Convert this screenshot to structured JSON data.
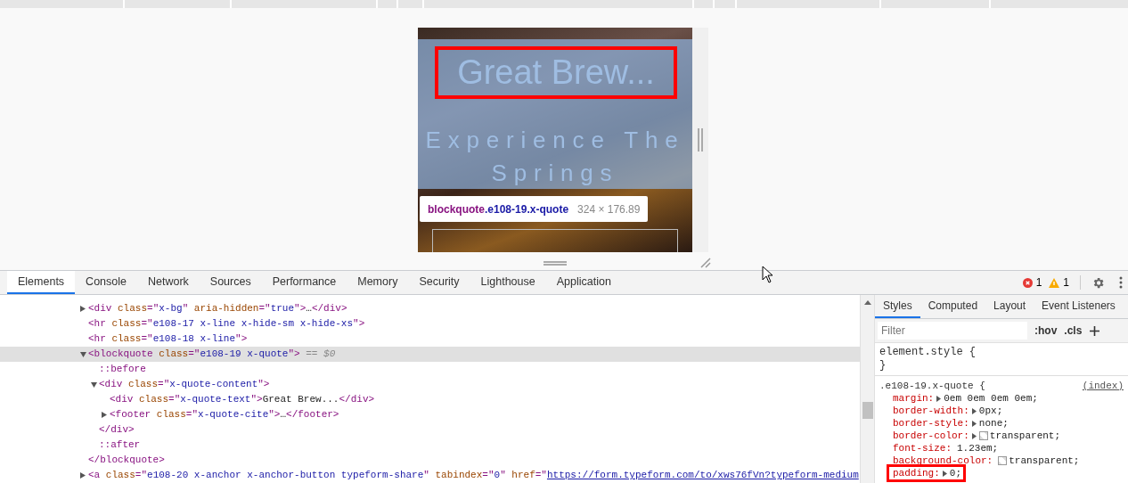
{
  "preview": {
    "quote_text": "Great Brew...",
    "quote_highlighted": true,
    "subtitle": "Experience The Springs",
    "tooltip": {
      "selector": "blockquote",
      "classes": ".e108-19.x-quote",
      "size": "324 × 176.89"
    }
  },
  "devtools": {
    "tabs": [
      {
        "label": "Elements",
        "selected": true
      },
      {
        "label": "Console",
        "selected": false
      },
      {
        "label": "Network",
        "selected": false
      },
      {
        "label": "Sources",
        "selected": false
      },
      {
        "label": "Performance",
        "selected": false
      },
      {
        "label": "Memory",
        "selected": false
      },
      {
        "label": "Security",
        "selected": false
      },
      {
        "label": "Lighthouse",
        "selected": false
      },
      {
        "label": "Application",
        "selected": false
      }
    ],
    "errors": "1",
    "warnings": "1",
    "dom_tree": [
      {
        "parts": [
          {
            "kind": "tag",
            "text": "<div "
          },
          {
            "kind": "attr",
            "text": "class"
          },
          {
            "kind": "tag",
            "text": "=\""
          },
          {
            "kind": "value",
            "text": "x-bg"
          },
          {
            "kind": "tag",
            "text": "\" "
          },
          {
            "kind": "attr",
            "text": "aria-hidden"
          },
          {
            "kind": "tag",
            "text": "=\""
          },
          {
            "kind": "value",
            "text": "true"
          },
          {
            "kind": "tag",
            "text": "\">"
          },
          {
            "kind": "text",
            "text": "…"
          },
          {
            "kind": "tag",
            "text": "</div>"
          }
        ],
        "expandable": true,
        "expanded": false,
        "selected": false
      },
      {
        "parts": [
          {
            "kind": "tag",
            "text": "<hr "
          },
          {
            "kind": "attr",
            "text": "class"
          },
          {
            "kind": "tag",
            "text": "=\""
          },
          {
            "kind": "value",
            "text": "e108-17 x-line  x-hide-sm x-hide-xs"
          },
          {
            "kind": "tag",
            "text": "\">"
          }
        ],
        "expandable": false,
        "selected": false
      },
      {
        "parts": [
          {
            "kind": "tag",
            "text": "<hr "
          },
          {
            "kind": "attr",
            "text": "class"
          },
          {
            "kind": "tag",
            "text": "=\""
          },
          {
            "kind": "value",
            "text": "e108-18 x-line"
          },
          {
            "kind": "tag",
            "text": "\">"
          }
        ],
        "expandable": false,
        "selected": false
      },
      {
        "parts": [
          {
            "kind": "tag",
            "text": "<blockquote "
          },
          {
            "kind": "attr",
            "text": "class"
          },
          {
            "kind": "tag",
            "text": "=\""
          },
          {
            "kind": "value",
            "text": "e108-19 x-quote"
          },
          {
            "kind": "tag",
            "text": "\">"
          },
          {
            "kind": "marker",
            "text": " == $0"
          }
        ],
        "expandable": true,
        "expanded": true,
        "selected": true,
        "close": "</blockquote>",
        "children": [
          {
            "parts": [
              {
                "kind": "pseudo",
                "text": "::before"
              }
            ],
            "expandable": false,
            "selected": false
          },
          {
            "parts": [
              {
                "kind": "tag",
                "text": "<div "
              },
              {
                "kind": "attr",
                "text": "class"
              },
              {
                "kind": "tag",
                "text": "=\""
              },
              {
                "kind": "value",
                "text": "x-quote-content"
              },
              {
                "kind": "tag",
                "text": "\">"
              }
            ],
            "expandable": true,
            "expanded": true,
            "selected": false,
            "close": "</div>",
            "children": [
              {
                "parts": [
                  {
                    "kind": "tag",
                    "text": "<div "
                  },
                  {
                    "kind": "attr",
                    "text": "class"
                  },
                  {
                    "kind": "tag",
                    "text": "=\""
                  },
                  {
                    "kind": "value",
                    "text": "x-quote-text"
                  },
                  {
                    "kind": "tag",
                    "text": "\">"
                  },
                  {
                    "kind": "text",
                    "text": "Great Brew..."
                  },
                  {
                    "kind": "tag",
                    "text": "</div>"
                  }
                ],
                "expandable": false,
                "selected": false
              },
              {
                "parts": [
                  {
                    "kind": "tag",
                    "text": "<footer "
                  },
                  {
                    "kind": "attr",
                    "text": "class"
                  },
                  {
                    "kind": "tag",
                    "text": "=\""
                  },
                  {
                    "kind": "value",
                    "text": "x-quote-cite"
                  },
                  {
                    "kind": "tag",
                    "text": "\">"
                  },
                  {
                    "kind": "text",
                    "text": "…"
                  },
                  {
                    "kind": "tag",
                    "text": "</footer>"
                  }
                ],
                "expandable": true,
                "expanded": false,
                "selected": false
              }
            ]
          },
          {
            "parts": [
              {
                "kind": "pseudo",
                "text": "::after"
              }
            ],
            "expandable": false,
            "selected": false
          }
        ]
      },
      {
        "parts": [
          {
            "kind": "tag",
            "text": "<a "
          },
          {
            "kind": "attr",
            "text": "class"
          },
          {
            "kind": "tag",
            "text": "=\""
          },
          {
            "kind": "value",
            "text": "e108-20 x-anchor x-anchor-button typeform-share"
          },
          {
            "kind": "tag",
            "text": "\" "
          },
          {
            "kind": "attr",
            "text": "tabindex"
          },
          {
            "kind": "tag",
            "text": "=\""
          },
          {
            "kind": "value",
            "text": "0"
          },
          {
            "kind": "tag",
            "text": "\" "
          },
          {
            "kind": "attr",
            "text": "href"
          },
          {
            "kind": "tag",
            "text": "=\""
          },
          {
            "kind": "link",
            "text": "https://form.typeform.com/to/xws76fVn?typeform-medium"
          }
        ],
        "expandable": true,
        "expanded": false,
        "selected": false
      }
    ],
    "side_tabs": [
      {
        "label": "Styles",
        "selected": true
      },
      {
        "label": "Computed",
        "selected": false
      },
      {
        "label": "Layout",
        "selected": false
      },
      {
        "label": "Event Listeners",
        "selected": false
      }
    ],
    "filter": {
      "placeholder": "Filter"
    },
    "hov": ":hov",
    "cls": ".cls",
    "element_style": {
      "open": "element.style {",
      "close": "}"
    },
    "rule": {
      "selector": ".e108-19.x-quote {",
      "source": "(index)",
      "declarations": [
        {
          "name": "margin:",
          "value": "0em 0em 0em 0em;",
          "expandable": true,
          "highlighted": false
        },
        {
          "name": "border-width:",
          "value": "0px;",
          "expandable": true,
          "highlighted": false
        },
        {
          "name": "border-style:",
          "value": "none;",
          "expandable": true,
          "highlighted": false
        },
        {
          "name": "border-color:",
          "value": "transparent;",
          "expandable": true,
          "swatch": true,
          "highlighted": false
        },
        {
          "name": "font-size:",
          "value": "1.23em;",
          "expandable": false,
          "highlighted": false
        },
        {
          "name": "background-color:",
          "value": "transparent;",
          "expandable": false,
          "swatch": true,
          "highlighted": false
        },
        {
          "name": "padding:",
          "value": "0;",
          "expandable": true,
          "highlighted": true
        }
      ]
    }
  }
}
